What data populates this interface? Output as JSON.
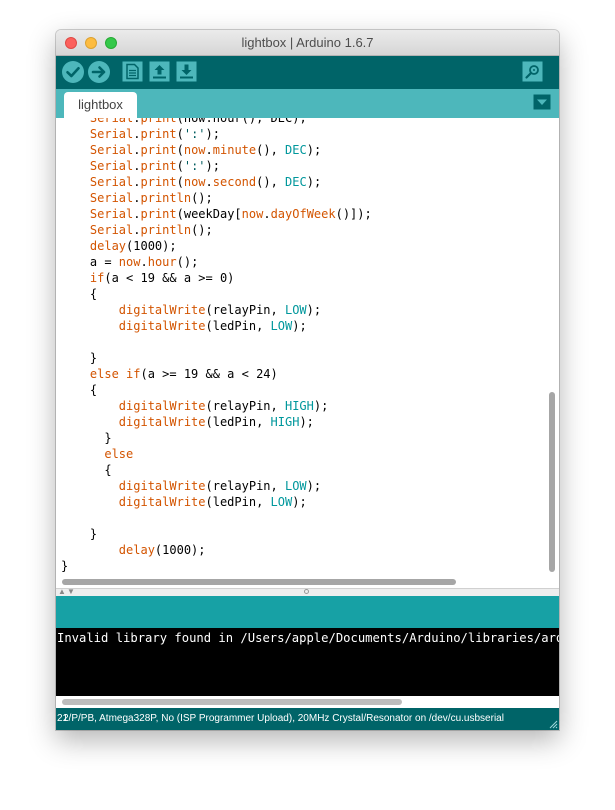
{
  "window": {
    "title": "lightbox | Arduino 1.6.7"
  },
  "toolbar": {
    "verify": "check-icon",
    "upload": "arrow-right-icon",
    "new": "new-file-icon",
    "open": "open-arrow-up-icon",
    "save": "save-arrow-down-icon",
    "serial_monitor": "magnifier-icon"
  },
  "tabs": [
    {
      "label": "lightbox"
    }
  ],
  "code": {
    "lines": [
      [
        [
          "    ",
          "p"
        ],
        [
          "Serial",
          "k"
        ],
        [
          ".",
          "p"
        ],
        [
          "print",
          "k"
        ],
        [
          "(now.hour(), DEC);",
          "p"
        ]
      ],
      [
        [
          "    ",
          "p"
        ],
        [
          "Serial",
          "k"
        ],
        [
          ".",
          "p"
        ],
        [
          "print",
          "k"
        ],
        [
          "(",
          "p"
        ],
        [
          "':'",
          "s"
        ],
        [
          ");",
          "p"
        ]
      ],
      [
        [
          "    ",
          "p"
        ],
        [
          "Serial",
          "k"
        ],
        [
          ".",
          "p"
        ],
        [
          "print",
          "k"
        ],
        [
          "(",
          "p"
        ],
        [
          "now",
          "k"
        ],
        [
          ".",
          "p"
        ],
        [
          "minute",
          "k"
        ],
        [
          "(), ",
          "p"
        ],
        [
          "DEC",
          "c"
        ],
        [
          ");",
          "p"
        ]
      ],
      [
        [
          "    ",
          "p"
        ],
        [
          "Serial",
          "k"
        ],
        [
          ".",
          "p"
        ],
        [
          "print",
          "k"
        ],
        [
          "(",
          "p"
        ],
        [
          "':'",
          "s"
        ],
        [
          ");",
          "p"
        ]
      ],
      [
        [
          "    ",
          "p"
        ],
        [
          "Serial",
          "k"
        ],
        [
          ".",
          "p"
        ],
        [
          "print",
          "k"
        ],
        [
          "(",
          "p"
        ],
        [
          "now",
          "k"
        ],
        [
          ".",
          "p"
        ],
        [
          "second",
          "k"
        ],
        [
          "(), ",
          "p"
        ],
        [
          "DEC",
          "c"
        ],
        [
          ");",
          "p"
        ]
      ],
      [
        [
          "    ",
          "p"
        ],
        [
          "Serial",
          "k"
        ],
        [
          ".",
          "p"
        ],
        [
          "println",
          "k"
        ],
        [
          "();",
          "p"
        ]
      ],
      [
        [
          "    ",
          "p"
        ],
        [
          "Serial",
          "k"
        ],
        [
          ".",
          "p"
        ],
        [
          "print",
          "k"
        ],
        [
          "(weekDay[",
          "p"
        ],
        [
          "now",
          "k"
        ],
        [
          ".",
          "p"
        ],
        [
          "dayOfWeek",
          "k"
        ],
        [
          "()]);",
          "p"
        ]
      ],
      [
        [
          "    ",
          "p"
        ],
        [
          "Serial",
          "k"
        ],
        [
          ".",
          "p"
        ],
        [
          "println",
          "k"
        ],
        [
          "();",
          "p"
        ]
      ],
      [
        [
          "    ",
          "p"
        ],
        [
          "delay",
          "k"
        ],
        [
          "(1000);",
          "p"
        ]
      ],
      [
        [
          "    a = ",
          "p"
        ],
        [
          "now",
          "k"
        ],
        [
          ".",
          "p"
        ],
        [
          "hour",
          "k"
        ],
        [
          "();",
          "p"
        ]
      ],
      [
        [
          "    ",
          "p"
        ],
        [
          "if",
          "k"
        ],
        [
          "(a < 19 && a >= 0)",
          "p"
        ]
      ],
      [
        [
          "    {",
          "p"
        ]
      ],
      [
        [
          "        ",
          "p"
        ],
        [
          "digitalWrite",
          "k"
        ],
        [
          "(relayPin, ",
          "p"
        ],
        [
          "LOW",
          "c"
        ],
        [
          ");",
          "p"
        ]
      ],
      [
        [
          "        ",
          "p"
        ],
        [
          "digitalWrite",
          "k"
        ],
        [
          "(ledPin, ",
          "p"
        ],
        [
          "LOW",
          "c"
        ],
        [
          ");",
          "p"
        ]
      ],
      [
        [
          "",
          "p"
        ]
      ],
      [
        [
          "    }",
          "p"
        ]
      ],
      [
        [
          "    ",
          "p"
        ],
        [
          "else if",
          "k"
        ],
        [
          "(a >= 19 && a < 24)",
          "p"
        ]
      ],
      [
        [
          "    {",
          "p"
        ]
      ],
      [
        [
          "        ",
          "p"
        ],
        [
          "digitalWrite",
          "k"
        ],
        [
          "(relayPin, ",
          "p"
        ],
        [
          "HIGH",
          "c"
        ],
        [
          ");",
          "p"
        ]
      ],
      [
        [
          "        ",
          "p"
        ],
        [
          "digitalWrite",
          "k"
        ],
        [
          "(ledPin, ",
          "p"
        ],
        [
          "HIGH",
          "c"
        ],
        [
          ");",
          "p"
        ]
      ],
      [
        [
          "      }",
          "p"
        ]
      ],
      [
        [
          "      ",
          "p"
        ],
        [
          "else",
          "k"
        ]
      ],
      [
        [
          "      {",
          "p"
        ]
      ],
      [
        [
          "        ",
          "p"
        ],
        [
          "digitalWrite",
          "k"
        ],
        [
          "(relayPin, ",
          "p"
        ],
        [
          "LOW",
          "c"
        ],
        [
          ");",
          "p"
        ]
      ],
      [
        [
          "        ",
          "p"
        ],
        [
          "digitalWrite",
          "k"
        ],
        [
          "(ledPin, ",
          "p"
        ],
        [
          "LOW",
          "c"
        ],
        [
          ");",
          "p"
        ]
      ],
      [
        [
          "",
          "p"
        ]
      ],
      [
        [
          "    }",
          "p"
        ]
      ],
      [
        [
          "        ",
          "p"
        ],
        [
          "delay",
          "k"
        ],
        [
          "(1000);",
          "p"
        ]
      ],
      [
        [
          "}",
          "p"
        ]
      ]
    ]
  },
  "console": {
    "text": "Invalid library found in /Users/apple/Documents/Arduino/libraries/arduino"
  },
  "status": {
    "line_number": "21",
    "board": "2/P/PB, Atmega328P, No (ISP Programmer Upload), 20MHz Crystal/Resonator on /dev/cu.usbserial"
  },
  "colors": {
    "keyword": "#d35400",
    "constant": "#00979c",
    "string": "#005c5f",
    "plain": "#000000",
    "toolbar": "#006468",
    "tabbar": "#4db7bb",
    "message_bar": "#17a1a5"
  }
}
